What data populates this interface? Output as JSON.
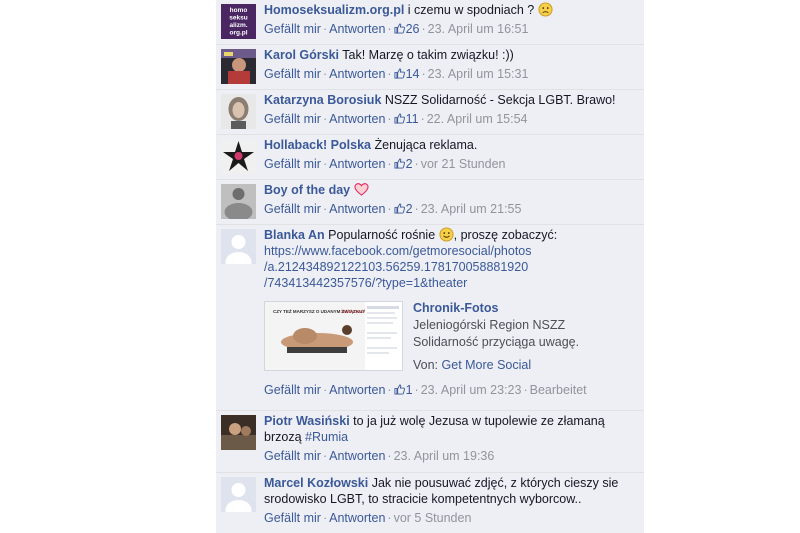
{
  "comments": [
    {
      "author": "Homoseksualizm.org.pl",
      "text": "i czemu w spodniach ?",
      "avatar_text": "homo seksu alizm. org.pl",
      "like_label": "Gefällt mir",
      "reply_label": "Antworten",
      "likes": "26",
      "time": "23. April um 16:51",
      "emoji": "frown-emoji"
    },
    {
      "author": "Karol Górski",
      "text": "Tak! Marzę o takim związku! :))",
      "like_label": "Gefällt mir",
      "reply_label": "Antworten",
      "likes": "14",
      "time": "23. April um 15:31"
    },
    {
      "author": "Katarzyna Borosiuk",
      "text": "NSZZ Solidarność - Sekcja LGBT. Brawo!",
      "like_label": "Gefällt mir",
      "reply_label": "Antworten",
      "likes": "11",
      "time": "22. April um 15:54"
    },
    {
      "author": "Hollaback! Polska",
      "text": "Żenująca reklama.",
      "like_label": "Gefällt mir",
      "reply_label": "Antworten",
      "likes": "2",
      "time": "vor 21 Stunden"
    },
    {
      "author": "Boy of the day",
      "text": "",
      "like_label": "Gefällt mir",
      "reply_label": "Antworten",
      "likes": "2",
      "time": "23. April um 21:55",
      "emoji": "heart-emoji"
    },
    {
      "author": "Blanka An",
      "text_before": "Popularność rośnie",
      "text_after": ", proszę zobaczyć:",
      "url_lines": [
        "https://www.facebook.com/getmoresocial/photos",
        "/a.212434892122103.56259.178170058881920",
        "/743413442357576/?type=1&theater"
      ],
      "attachment": {
        "image_caption": "CZY TEŻ MARZYSZ O UDANYM ZWIĄZKU?",
        "title": "Chronik-Fotos",
        "description": "Jeleniogórski Region NSZZ Solidarność przyciąga uwagę.",
        "source_prefix": "Von:",
        "source": "Get More Social"
      },
      "like_label": "Gefällt mir",
      "reply_label": "Antworten",
      "likes": "1",
      "time": "23. April um 23:23",
      "edited": "Bearbeitet",
      "emoji": "smile-emoji"
    },
    {
      "author": "Piotr Wasiński",
      "text": "to ja już wolę Jezusa w tupolewie ze złamaną brzozą",
      "hashtag": "#Rumia",
      "like_label": "Gefällt mir",
      "reply_label": "Antworten",
      "time": "23. April um 19:36"
    },
    {
      "author": "Marcel Kozłowski",
      "text": "Jak nie pousuwać zdjęć, z których cieszy sie srodowisko LGBT, to stracicie kompetentnych wyborcow..",
      "like_label": "Gefällt mir",
      "reply_label": "Antworten",
      "time": "vor 5 Stunden"
    }
  ],
  "colors": {
    "link": "#3b5998",
    "meta": "#90949c",
    "background": "#edeff4"
  }
}
